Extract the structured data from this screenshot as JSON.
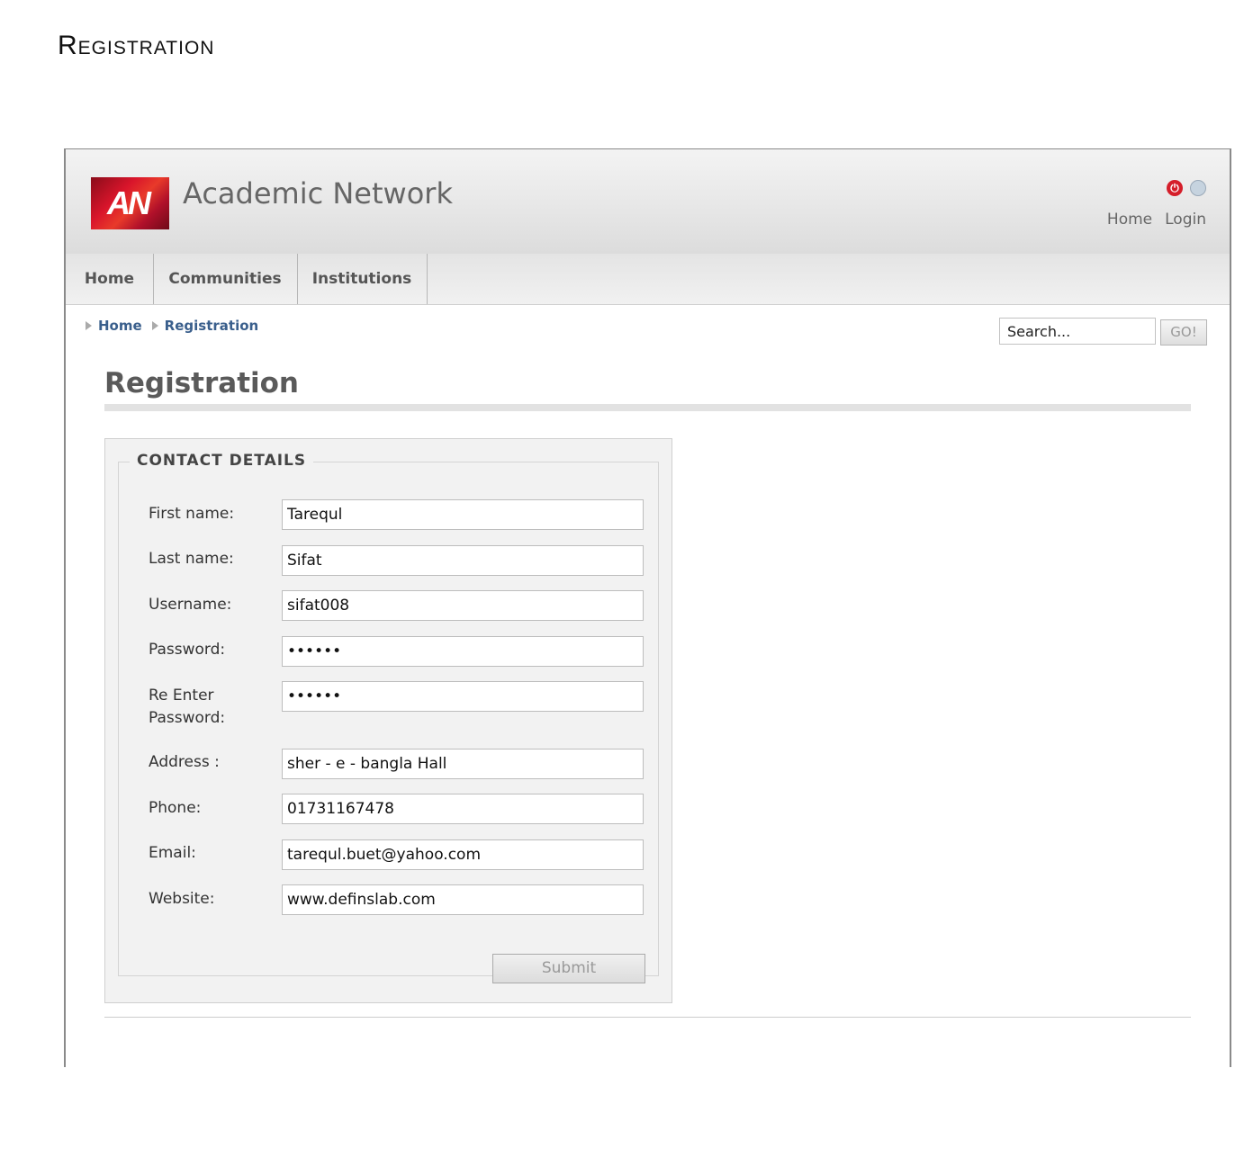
{
  "doc_heading": "Registration",
  "site": {
    "logo_text": "AN",
    "title": "Academic Network"
  },
  "top_links": {
    "home": "Home",
    "login": "Login"
  },
  "nav": {
    "items": [
      "Home",
      "Communities",
      "Institutions"
    ]
  },
  "breadcrumb": {
    "items": [
      "Home",
      "Registration"
    ]
  },
  "search": {
    "placeholder": "Search...",
    "button": "GO!"
  },
  "page_title": "Registration",
  "form": {
    "legend": "CONTACT DETAILS",
    "fields": [
      {
        "label": "First name:",
        "value": "Tarequl"
      },
      {
        "label": "Last name:",
        "value": "Sifat"
      },
      {
        "label": "Username:",
        "value": "sifat008"
      },
      {
        "label": "Password:",
        "value": "••••••"
      },
      {
        "label": "Re Enter Password:",
        "value": "••••••"
      },
      {
        "label": "Address :",
        "value": "sher - e - bangla Hall"
      },
      {
        "label": "Phone:",
        "value": "01731167478"
      },
      {
        "label": "Email:",
        "value": "tarequl.buet@yahoo.com"
      },
      {
        "label": "Website:",
        "value": "www.definslab.com"
      }
    ],
    "submit": "Submit"
  }
}
